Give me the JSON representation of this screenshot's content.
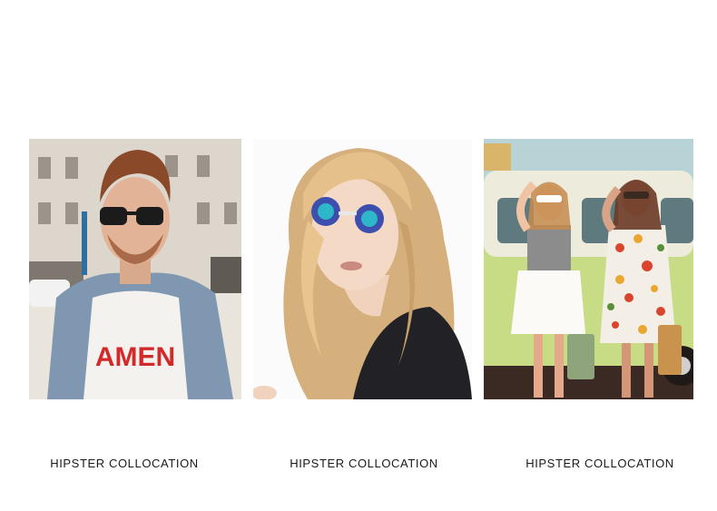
{
  "gallery": {
    "items": [
      {
        "photo_subject": "man-with-sunglasses-photo",
        "caption": "HIPSTER COLLOCATION",
        "shirt_text": "AMEN"
      },
      {
        "photo_subject": "blonde-woman-with-mirrored-sunglasses-photo",
        "caption": "HIPSTER COLLOCATION"
      },
      {
        "photo_subject": "two-women-by-green-van-photo",
        "caption": "HIPSTER COLLOCATION"
      }
    ]
  },
  "colors": {
    "caption_text": "#1a1a1a",
    "background": "#ffffff"
  }
}
